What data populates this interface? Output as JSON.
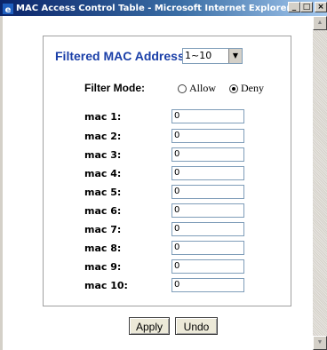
{
  "window": {
    "title": "MAC Access Control Table - Microsoft Internet Explorer",
    "minimize_icon": "minimize-icon",
    "maximize_icon": "maximize-icon",
    "close_icon": "close-icon"
  },
  "form": {
    "heading": "Filtered MAC Address:",
    "range_select": {
      "value": "1~10"
    },
    "filter_mode": {
      "label": "Filter Mode:",
      "options": [
        {
          "label": "Allow",
          "checked": false
        },
        {
          "label": "Deny",
          "checked": true
        }
      ]
    },
    "entries": [
      {
        "label": "mac 1:",
        "value": "0"
      },
      {
        "label": "mac 2:",
        "value": "0"
      },
      {
        "label": "mac 3:",
        "value": "0"
      },
      {
        "label": "mac 4:",
        "value": "0"
      },
      {
        "label": "mac 5:",
        "value": "0"
      },
      {
        "label": "mac 6:",
        "value": "0"
      },
      {
        "label": "mac 7:",
        "value": "0"
      },
      {
        "label": "mac 8:",
        "value": "0"
      },
      {
        "label": "mac 9:",
        "value": "0"
      },
      {
        "label": "mac 10:",
        "value": "0"
      }
    ]
  },
  "buttons": {
    "apply": "Apply",
    "undo": "Undo"
  },
  "colors": {
    "heading": "#1a3fa8",
    "titlebar_start": "#0a246a",
    "titlebar_end": "#a6caf0"
  }
}
